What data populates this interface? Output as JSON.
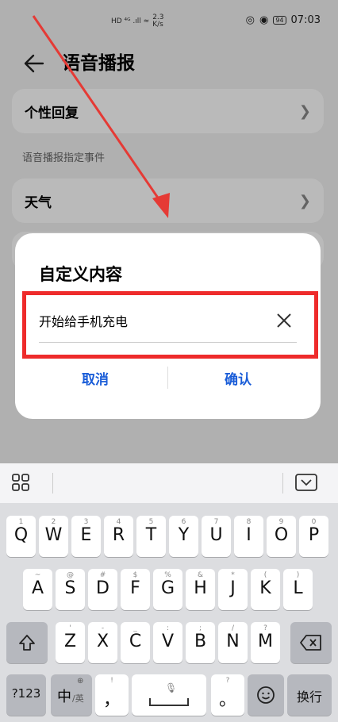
{
  "status": {
    "left_icons": "HD ⁴ᴳ .ıll ≈",
    "speed_value": "2.3",
    "speed_unit": "K/s",
    "battery": "94",
    "time": "07:03"
  },
  "header": {
    "title": "语音播报"
  },
  "settings": {
    "row1": "个性回复",
    "section": "语音播报指定事件",
    "row2": "天气"
  },
  "dialog": {
    "title": "自定义内容",
    "input_value": "开始给手机充电",
    "cancel": "取消",
    "confirm": "确认"
  },
  "keyboard": {
    "row1": [
      {
        "main": "Q",
        "sub": "1"
      },
      {
        "main": "W",
        "sub": "2"
      },
      {
        "main": "E",
        "sub": "3"
      },
      {
        "main": "R",
        "sub": "4"
      },
      {
        "main": "T",
        "sub": "5"
      },
      {
        "main": "Y",
        "sub": "6"
      },
      {
        "main": "U",
        "sub": "7"
      },
      {
        "main": "I",
        "sub": "8"
      },
      {
        "main": "O",
        "sub": "9"
      },
      {
        "main": "P",
        "sub": "0"
      }
    ],
    "row2": [
      {
        "main": "A",
        "sub": "~"
      },
      {
        "main": "S",
        "sub": "@"
      },
      {
        "main": "D",
        "sub": "#"
      },
      {
        "main": "F",
        "sub": "$"
      },
      {
        "main": "G",
        "sub": "%"
      },
      {
        "main": "H",
        "sub": "&"
      },
      {
        "main": "J",
        "sub": "*"
      },
      {
        "main": "K",
        "sub": "("
      },
      {
        "main": "L",
        "sub": ")"
      }
    ],
    "row3": [
      {
        "main": "Z",
        "sub": "'"
      },
      {
        "main": "X",
        "sub": "-"
      },
      {
        "main": "C",
        "sub": "_"
      },
      {
        "main": "V",
        "sub": ":"
      },
      {
        "main": "B",
        "sub": ";"
      },
      {
        "main": "N",
        "sub": "/"
      },
      {
        "main": "M",
        "sub": "?"
      }
    ],
    "numbers": "?123",
    "lang_main": "中",
    "lang_sub": "/英",
    "comma": "，",
    "comma_sub": "!",
    "period": "。",
    "period_sub": "?",
    "enter": "换行"
  }
}
